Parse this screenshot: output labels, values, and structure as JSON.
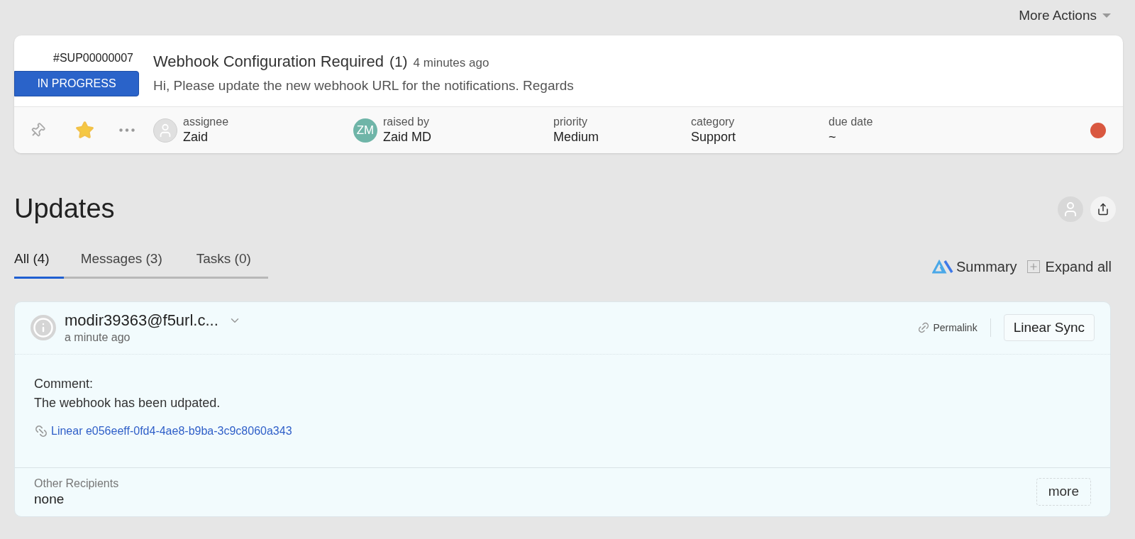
{
  "more_actions": "More Actions",
  "ticket": {
    "id": "#SUP00000007",
    "status": "IN PROGRESS",
    "title": "Webhook Configuration Required",
    "count": "(1)",
    "time": "4 minutes ago",
    "description": "Hi, Please update the new webhook URL for the notifications. Regards",
    "pinned": false,
    "starred": true,
    "fields": [
      {
        "kind": "avatar",
        "label": "assignee",
        "value": "Zaid"
      },
      {
        "kind": "initials",
        "label": "raised by",
        "value": "Zaid MD",
        "initials": "ZM"
      },
      {
        "kind": "plain",
        "label": "priority",
        "value": "Medium"
      },
      {
        "kind": "plain",
        "label": "category",
        "value": "Support"
      },
      {
        "kind": "plain",
        "label": "due date",
        "value": "~"
      }
    ]
  },
  "updates": {
    "title": "Updates",
    "tabs": [
      {
        "label": "All (4)",
        "selected": true
      },
      {
        "label": "Messages (3)",
        "selected": false
      },
      {
        "label": "Tasks (0)",
        "selected": false
      }
    ],
    "summary": "Summary",
    "expand_all": "Expand all",
    "entry": {
      "author": "modir39363@f5url.c...",
      "time": "a minute ago",
      "permalink": "Permalink",
      "sync_button": "Linear Sync",
      "comment_label": "Comment:",
      "comment": "The webhook has been udpated.",
      "link": "Linear e056eeff-0fd4-4ae8-b9ba-3c9c8060a343",
      "recipients_label": "Other Recipients",
      "recipients": "none",
      "more": "more"
    }
  }
}
